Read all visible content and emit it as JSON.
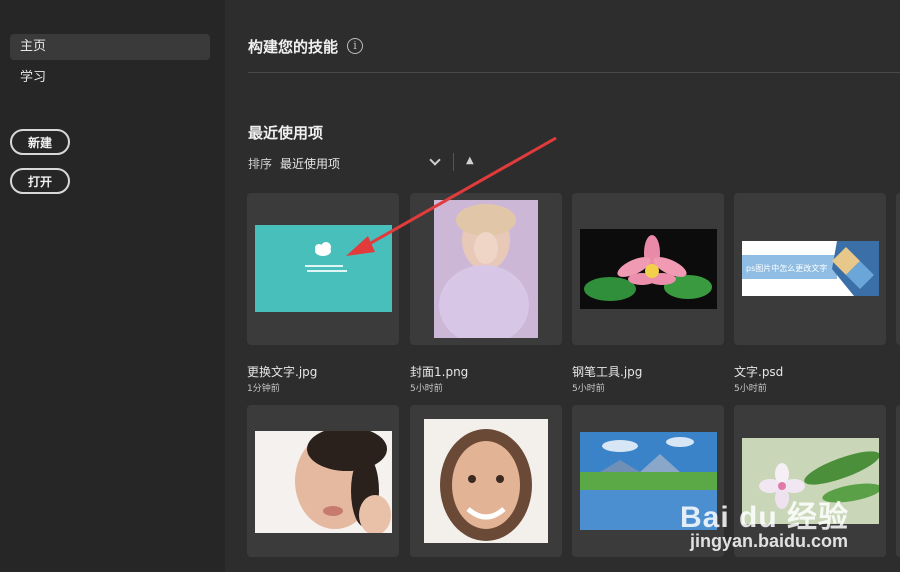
{
  "sidebar": {
    "items": [
      {
        "label": "主页",
        "active": true
      },
      {
        "label": "学习",
        "active": false
      }
    ],
    "new_label": "新建",
    "open_label": "打开"
  },
  "main": {
    "skills_heading": "构建您的技能",
    "info_icon": "info-icon",
    "recent_title": "最近使用项",
    "sort_label": "排序",
    "sort_value": "最近使用项",
    "sort_direction_icon": "arrow-up-icon"
  },
  "recent_files": [
    {
      "name": "更换文字.jpg",
      "time": "1分钟前"
    },
    {
      "name": "封面1.png",
      "time": "5小时前"
    },
    {
      "name": "钢笔工具.jpg",
      "time": "5小时前"
    },
    {
      "name": "文字.psd",
      "time": "5小时前"
    },
    {
      "name": "",
      "time": ""
    },
    {
      "name": "",
      "time": ""
    },
    {
      "name": "",
      "time": ""
    },
    {
      "name": "",
      "time": ""
    }
  ],
  "thumbnail_text": {
    "card4_banner": "ps图片中怎么更改文字"
  },
  "watermark": {
    "brand": "Bai du 经验",
    "url": "jingyan.baidu.com"
  },
  "colors": {
    "background": "#2d2d2d",
    "sidebar": "#262626",
    "card": "#3b3b3b",
    "annotation_arrow": "#e23b3b",
    "teal_thumbnail": "#48bfba"
  }
}
